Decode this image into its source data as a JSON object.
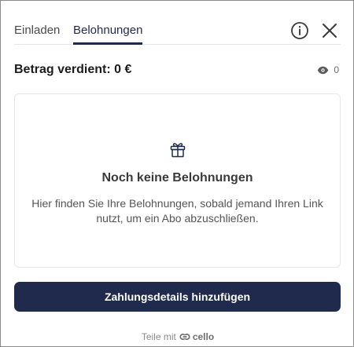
{
  "tabs": [
    {
      "label": "Einladen",
      "active": false
    },
    {
      "label": "Belohnungen",
      "active": true
    }
  ],
  "icons": {
    "info": "info-icon",
    "close": "close-icon",
    "views": "eye-icon",
    "gift": "gift-icon",
    "brand": "cello-logo-icon"
  },
  "earnings": {
    "label": "Betrag verdient: 0 €",
    "views_count": "0"
  },
  "empty_state": {
    "title": "Noch keine Belohnungen",
    "text": "Hier finden Sie Ihre Belohnungen, sobald jemand Ihren Link nutzt, um ein Abo abzuschließen."
  },
  "cta": {
    "label": "Zahlungsdetails hinzufügen"
  },
  "footer": {
    "prefix": "Teile mit",
    "brand": "cello"
  },
  "colors": {
    "primary": "#1f2a4d",
    "border": "#e6e7eb",
    "muted": "#8b8b8b"
  }
}
